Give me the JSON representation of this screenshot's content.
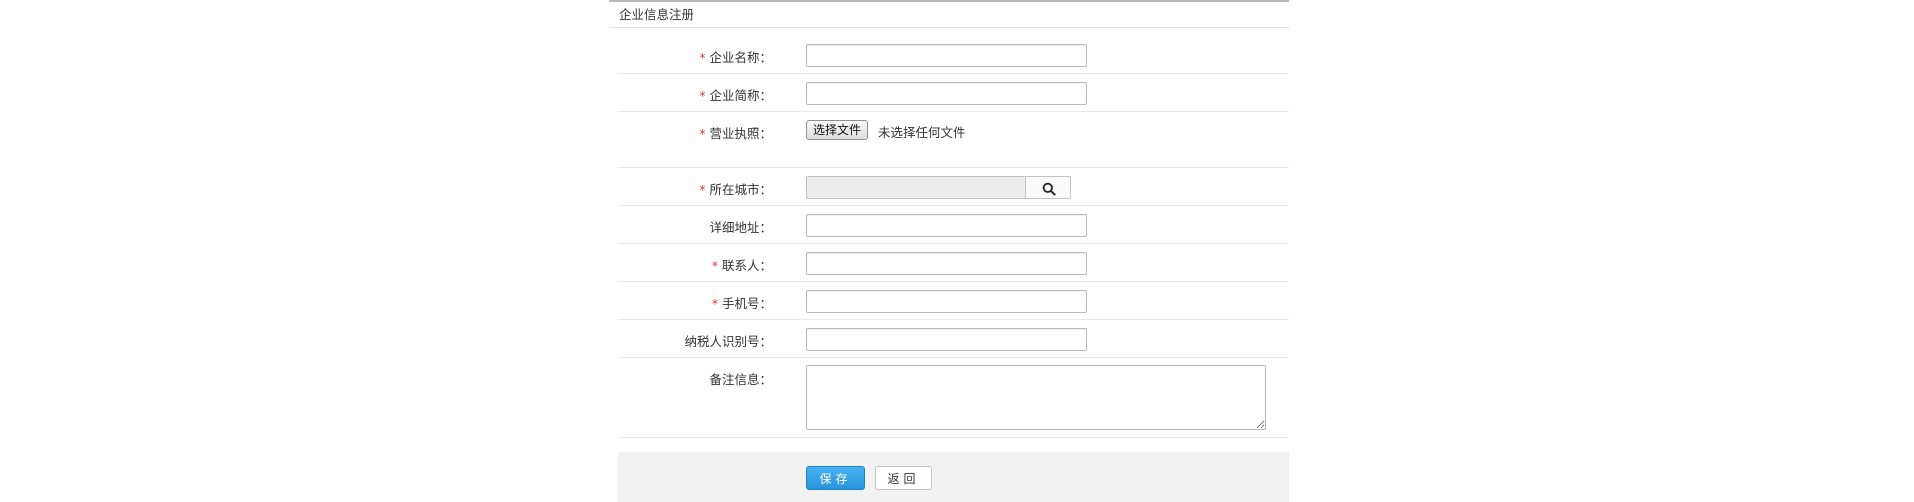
{
  "panel": {
    "title": "企业信息注册"
  },
  "fields": {
    "company_name": {
      "label": "企业名称：",
      "required_mark": "*",
      "value": ""
    },
    "company_short": {
      "label": "企业简称：",
      "required_mark": "*",
      "value": ""
    },
    "license": {
      "label": "营业执照：",
      "required_mark": "*",
      "button_label": "选择文件",
      "status_text": "未选择任何文件"
    },
    "city": {
      "label": "所在城市：",
      "required_mark": "*",
      "value": "",
      "search_icon": "search-icon"
    },
    "address": {
      "label": "详细地址：",
      "value": ""
    },
    "contact": {
      "label": "联系人：",
      "required_mark": "*",
      "value": ""
    },
    "phone": {
      "label": "手机号：",
      "required_mark": "*",
      "value": ""
    },
    "tax_id": {
      "label": "纳税人识别号：",
      "value": ""
    },
    "remarks": {
      "label": "备注信息：",
      "value": ""
    }
  },
  "actions": {
    "save_label": "保存",
    "back_label": "返回"
  },
  "colors": {
    "required": "#e0382c",
    "primary_button": "#2a94dc",
    "footer_bg": "#f2f2f2"
  }
}
